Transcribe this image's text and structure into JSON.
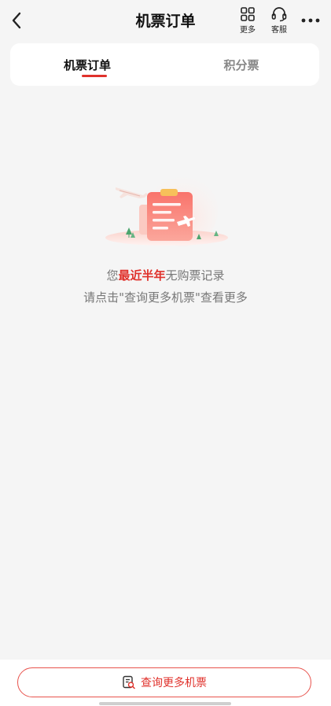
{
  "nav": {
    "title": "机票订单",
    "more_label": "更多",
    "service_label": "客服",
    "back_icon": "chevron-left-icon",
    "more_icon": "grid-icon",
    "service_icon": "headset-icon",
    "menu_icon": "ellipsis-icon"
  },
  "tabs": [
    {
      "label": "机票订单",
      "active": true
    },
    {
      "label": "积分票",
      "active": false
    }
  ],
  "empty_state": {
    "line1_prefix": "您",
    "line1_highlight": "最近半年",
    "line1_suffix": "无购票记录",
    "line2": "请点击\"查询更多机票\"查看更多",
    "illustration_icon": "empty-ticket-illustration"
  },
  "bottom": {
    "query_button_label": "查询更多机票",
    "query_icon": "search-document-icon"
  },
  "colors": {
    "accent": "#e0312b",
    "background": "#f5f5f5",
    "muted_text": "#777777"
  }
}
